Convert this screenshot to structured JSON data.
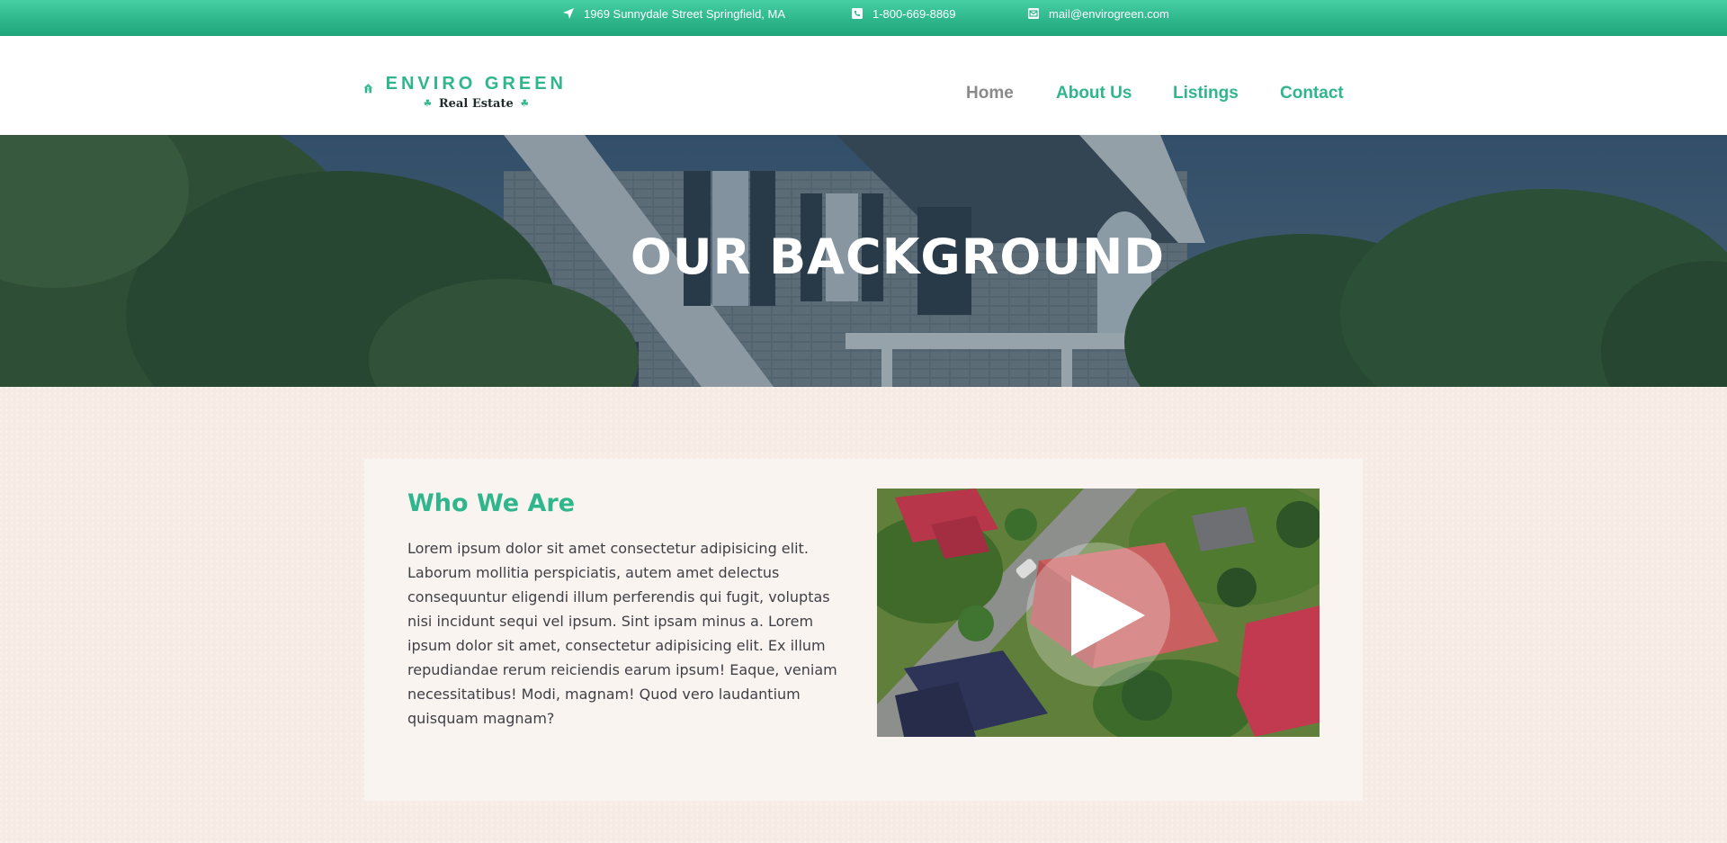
{
  "topbar": {
    "address": "1969 Sunnydale Street Springfield, MA",
    "phone": "1-800-669-8869",
    "email": "mail@envirogreen.com",
    "icons": [
      "location-arrow-icon",
      "phone-icon",
      "envelope-icon"
    ]
  },
  "brand": {
    "name": "ENVIRO GREEN",
    "tagline": "Real Estate",
    "color": "#2fb68d"
  },
  "nav": {
    "items": [
      {
        "label": "Home",
        "active": true
      },
      {
        "label": "About Us",
        "active": false
      },
      {
        "label": "Listings",
        "active": false
      },
      {
        "label": "Contact",
        "active": false
      }
    ]
  },
  "hero": {
    "title": "OUR BACKGROUND"
  },
  "about": {
    "heading": "Who We Are",
    "body": "Lorem ipsum dolor sit amet consectetur adipisicing elit. Laborum mollitia perspiciatis, autem amet delectus consequuntur eligendi illum perferendis qui fugit, voluptas nisi incidunt sequi vel ipsum. Sint ipsam minus a. Lorem ipsum dolor sit amet, consectetur adipisicing elit. Ex illum repudiandae rerum reiciendis earum ipsum! Eaque, veniam necessitatibus! Modi, magnam! Quod vero laudantium quisquam magnam?",
    "video_icon": "play-icon"
  },
  "colors": {
    "accent": "#2fb68d",
    "nav_active": "#8a8a8a",
    "page_background": "#f7ece5"
  }
}
